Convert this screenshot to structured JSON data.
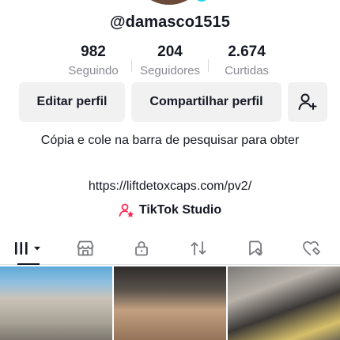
{
  "profile": {
    "username": "@damasco1515"
  },
  "stats": [
    {
      "value": "982",
      "label": "Seguindo"
    },
    {
      "value": "204",
      "label": "Seguidores"
    },
    {
      "value": "2.674",
      "label": "Curtidas"
    }
  ],
  "actions": {
    "edit_label": "Editar perfil",
    "share_label": "Compartilhar perfil"
  },
  "bio": {
    "text": "Cópia e cole na barra de pesquisar para obter",
    "link": "https://liftdetoxcaps.com/pv2/"
  },
  "studio": {
    "label": "TikTok Studio"
  },
  "tabs": [
    {
      "icon": "grid-icon",
      "active": true
    },
    {
      "icon": "shop-icon",
      "active": false
    },
    {
      "icon": "lock-icon",
      "active": false
    },
    {
      "icon": "repost-icon",
      "active": false
    },
    {
      "icon": "favorites-icon",
      "active": false
    },
    {
      "icon": "liked-icon",
      "active": false
    }
  ],
  "colors": {
    "text": "#161823",
    "secondary": "#8a8b91",
    "button_bg": "#f1f1f2",
    "studio_accent": "#fe2c55"
  }
}
